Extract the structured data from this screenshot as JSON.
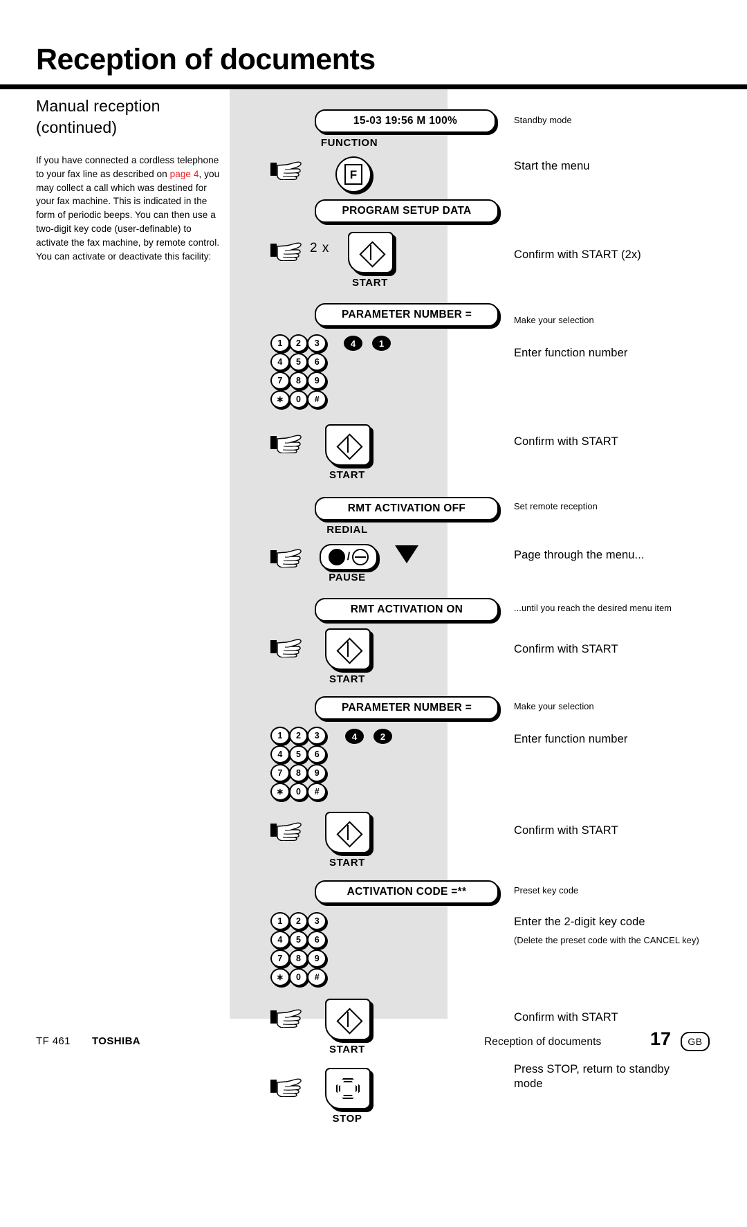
{
  "header": {
    "title": "Reception of documents"
  },
  "left": {
    "heading_line1": "Manual reception",
    "heading_line2": "(continued)",
    "para_before_link": "If you have connected a cordless telephone to your fax line as described on ",
    "link_text": "page 4",
    "para_after_link": ", you may collect a call which was destined for your fax machine. This is indicated in the form of periodic beeps. You can then use a two-digit key code (user-definable) to activate the fax machine, by remote control. You can activate or deactivate this facility:",
    "link_color": "#ee1c25"
  },
  "steps": {
    "lcd_standby": "15-03 19:56  M 100%",
    "label_function": "FUNCTION",
    "function_key_glyph": "F",
    "lcd_program_setup": "PROGRAM SETUP DATA",
    "multiplier_2x": "2 x",
    "label_start_1": "START",
    "lcd_parameter_number_1": "PARAMETER NUMBER =",
    "entered_digits_1": [
      "4",
      "1"
    ],
    "label_start_2": "START",
    "lcd_rmt_off": "RMT ACTIVATION  OFF",
    "label_redial": "REDIAL",
    "label_pause": "PAUSE",
    "lcd_rmt_on": "RMT ACTIVATION  ON",
    "label_start_3": "START",
    "lcd_parameter_number_2": "PARAMETER NUMBER =",
    "entered_digits_2": [
      "4",
      "2"
    ],
    "label_start_4": "START",
    "lcd_activation_code": "ACTIVATION CODE  =**",
    "label_start_5": "START",
    "label_stop": "STOP"
  },
  "keypad": {
    "rows": [
      [
        "1",
        "2",
        "3"
      ],
      [
        "4",
        "5",
        "6"
      ],
      [
        "7",
        "8",
        "9"
      ],
      [
        "∗",
        "0",
        "#"
      ]
    ]
  },
  "notes": {
    "standby_mode": "Standby mode",
    "start_the_menu": "Start the menu",
    "confirm_start_2x": "Confirm with START (2x)",
    "make_selection_1": "Make your selection",
    "enter_function_number_1": "Enter function number",
    "confirm_start_1": "Confirm with START",
    "set_remote_reception": "Set remote reception",
    "page_through_menu": "Page through the menu...",
    "until_desired_item": "...until you reach the desired menu item",
    "confirm_start_2": "Confirm with START",
    "make_selection_2": "Make your selection",
    "enter_function_number_2": "Enter function number",
    "confirm_start_3": "Confirm with START",
    "preset_key_code": "Preset key code",
    "enter_2_digit_code": "Enter the 2-digit key code",
    "delete_preset_note": "(Delete the preset code with the CANCEL key)",
    "confirm_start_4": "Confirm with START",
    "press_stop": "Press STOP, return to standby mode"
  },
  "footer": {
    "model": "TF 461",
    "brand": "TOSHIBA",
    "section": "Reception of documents",
    "page_number": "17",
    "language": "GB"
  }
}
